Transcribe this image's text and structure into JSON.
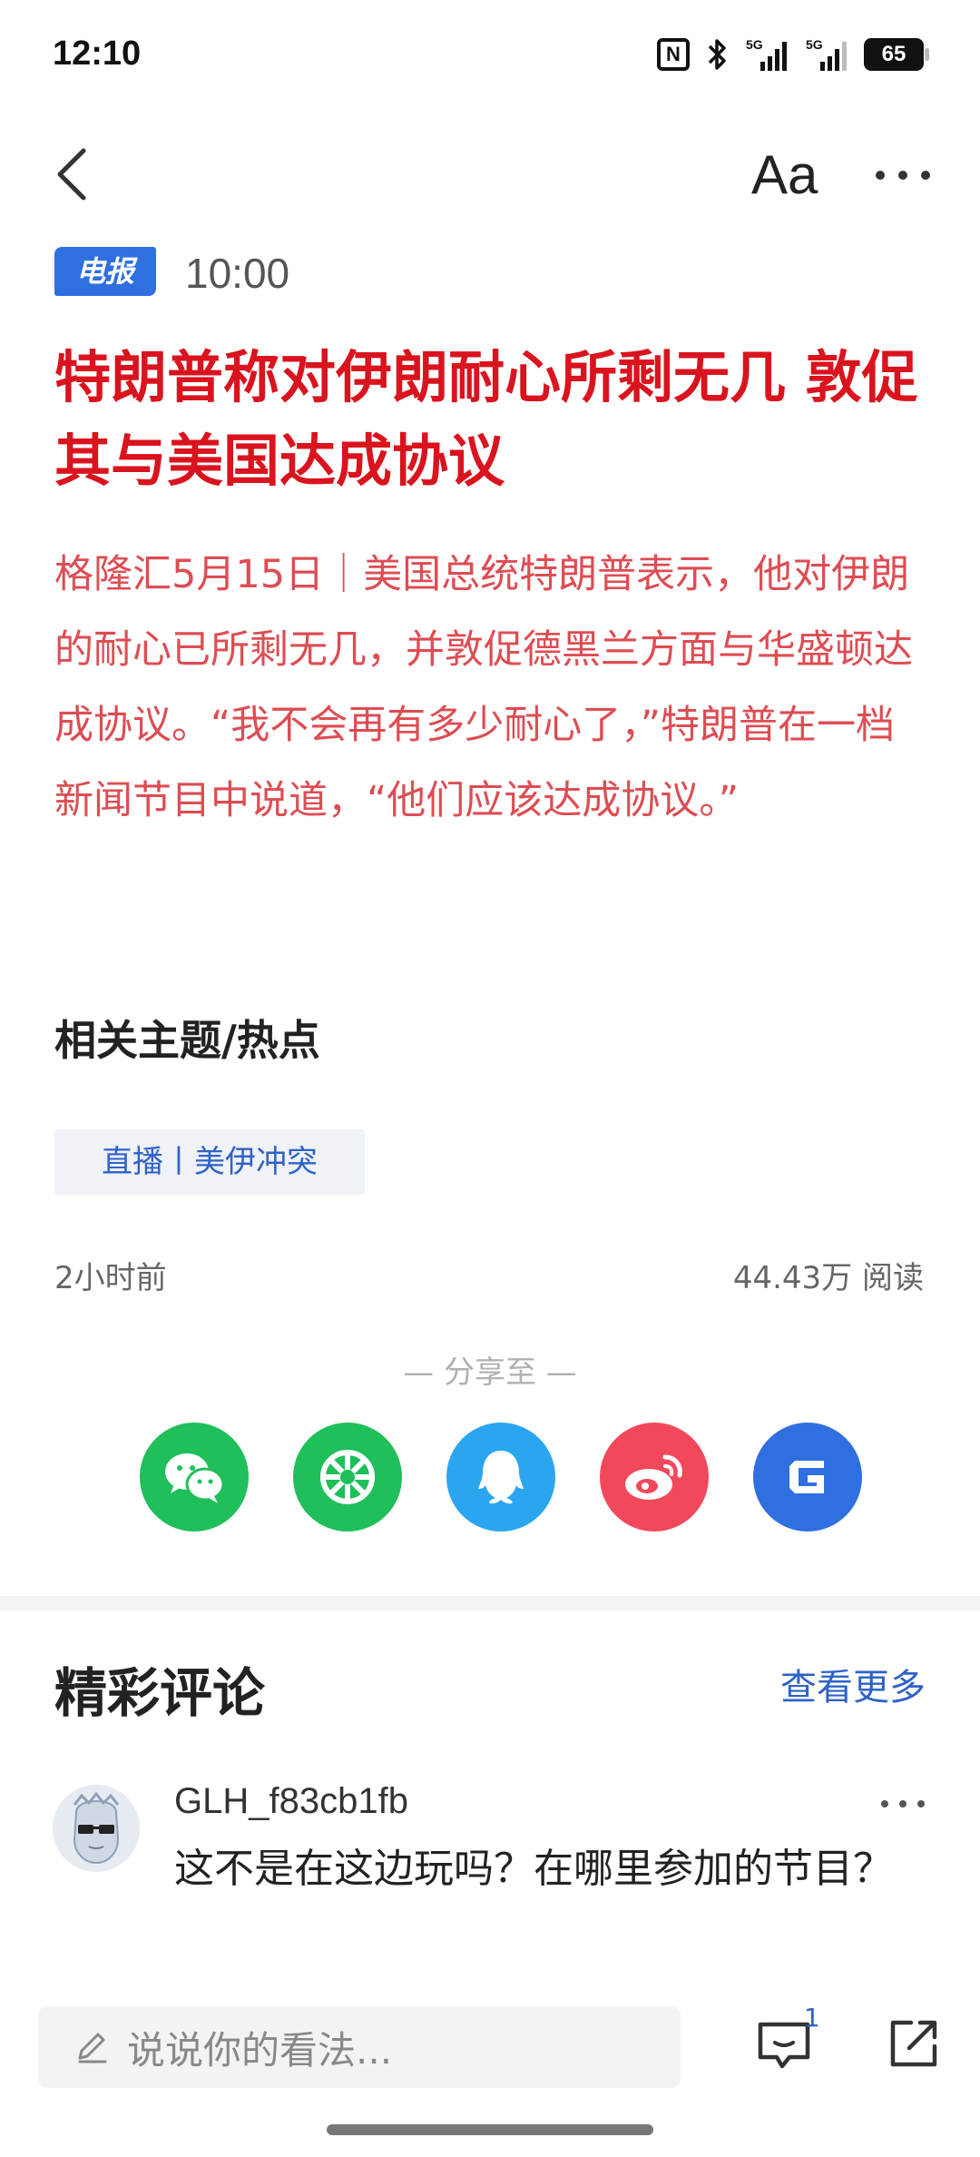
{
  "status_bar": {
    "time": "12:10",
    "nfc_label": "N",
    "network1": "5G",
    "network2": "5G",
    "battery": "65"
  },
  "nav": {
    "font_size_label": "Aa"
  },
  "article": {
    "tag": "电报",
    "time": "10:00",
    "title": "特朗普称对伊朗耐心所剩无几 敦促其与美国达成协议",
    "body": "格隆汇5月15日｜美国总统特朗普表示，他对伊朗的耐心已所剩无几，并敦促德黑兰方面与华盛顿达成协议。“我不会再有多少耐心了，”特朗普在一档新闻节目中说道，“他们应该达成协议。”"
  },
  "related": {
    "title": "相关主题/热点",
    "chip": "直播丨美伊冲突",
    "published_ago": "2小时前",
    "reads": "44.43万 阅读"
  },
  "share": {
    "label": "— 分享至 —",
    "targets": [
      {
        "name": "wechat-icon",
        "color": "#1fbf5a"
      },
      {
        "name": "moments-icon",
        "color": "#1fbf5a"
      },
      {
        "name": "qq-icon",
        "color": "#2aa6f0"
      },
      {
        "name": "weibo-icon",
        "color": "#f2485b"
      },
      {
        "name": "gelonghui-icon",
        "color": "#2f6fe0"
      }
    ]
  },
  "comments": {
    "title": "精彩评论",
    "more_label": "查看更多",
    "items": [
      {
        "user": "GLH_f83cb1fb",
        "text": "这不是在这边玩吗？在哪里参加的节目？"
      }
    ]
  },
  "bottom_bar": {
    "input_placeholder": "说说你的看法...",
    "comment_count": "1"
  },
  "colors": {
    "title_red": "#d9141e",
    "body_red": "#dd4d53",
    "link_blue": "#2f62c8",
    "badge_blue": "#2f6fe0"
  }
}
